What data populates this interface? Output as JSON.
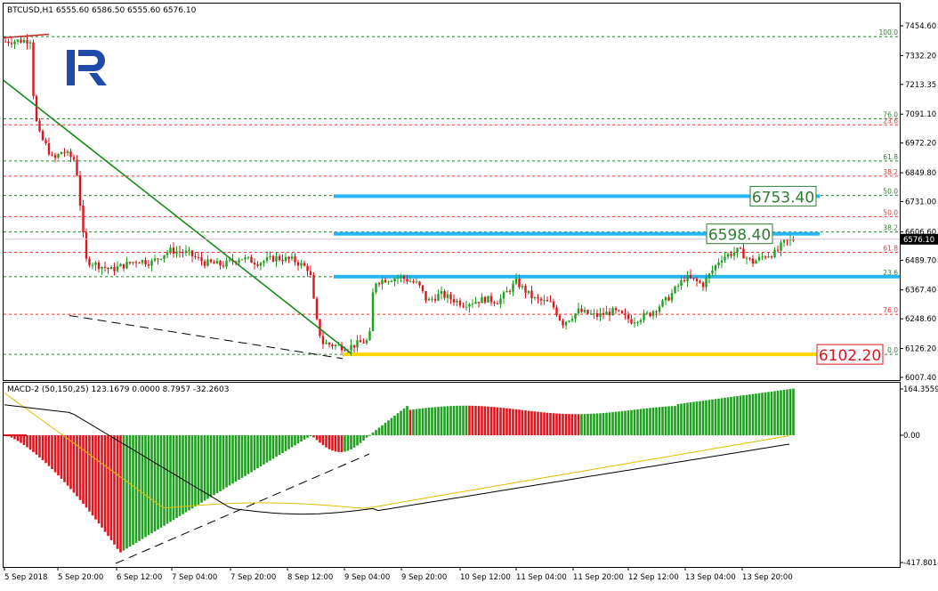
{
  "header": {
    "symbol_info": "BTCUSD,H1  6555.60 6586.50 6555.60 6576.10",
    "macd_info": "MACD-2 (50,150,25) 123.1679 0.0000 8.7957 -32.2603"
  },
  "colors": {
    "bull": "#1f9f1f",
    "bear": "#e0141e",
    "trendline": "#1a8a1a",
    "fib_green": "#2e7d32",
    "fib_red": "#e53935",
    "fib_level_line": "#2e7d32",
    "cyan_zone": "#29b6f6",
    "yellow_zone": "#ffd600",
    "macd_signal": "#e0c000",
    "macd_main": "#000000",
    "logo": "#1f4aa8"
  },
  "chart_data": [
    {
      "type": "candlestick",
      "symbol": "BTCUSD",
      "timeframe": "H1",
      "ohlc_last": {
        "open": 6555.6,
        "high": 6586.5,
        "low": 6555.6,
        "close": 6576.1
      },
      "current_price": "6576.10",
      "ylim": [
        6007.4,
        7500.0
      ],
      "y_ticks": [
        "7454.60",
        "7332.20",
        "7213.35",
        "7091.10",
        "6972.20",
        "6849.80",
        "6731.00",
        "6606.60",
        "6489.70",
        "6367.40",
        "6248.60",
        "6126.20",
        "6007.40"
      ],
      "x_ticks": [
        "5 Sep 2018",
        "5 Sep 20:00",
        "6 Sep 12:00",
        "7 Sep 04:00",
        "7 Sep 20:00",
        "8 Sep 12:00",
        "9 Sep 04:00",
        "9 Sep 20:00",
        "10 Sep 12:00",
        "11 Sep 04:00",
        "11 Sep 20:00",
        "12 Sep 12:00",
        "13 Sep 04:00",
        "13 Sep 20:00"
      ],
      "fib_levels_left": [
        {
          "label": "100.0",
          "price": 7410,
          "color": "green"
        },
        {
          "label": "76.0",
          "price": 7072,
          "color": "green"
        },
        {
          "label": "23.6",
          "price": 7047,
          "color": "red"
        },
        {
          "label": "61.8",
          "price": 6898,
          "color": "green"
        },
        {
          "label": "38.2",
          "price": 6836,
          "color": "red"
        },
        {
          "label": "50.0",
          "price": 6756,
          "color": "green"
        },
        {
          "label": "50.0",
          "price": 6669,
          "color": "red"
        },
        {
          "label": "38.2",
          "price": 6606,
          "color": "green"
        },
        {
          "label": "61.8",
          "price": 6522,
          "color": "red"
        },
        {
          "label": "23.6",
          "price": 6422,
          "color": "green"
        },
        {
          "label": "76.0",
          "price": 6267,
          "color": "red"
        },
        {
          "label": "0.0",
          "price": 6102,
          "color": "green"
        }
      ],
      "annotations": [
        {
          "text": "6753.40",
          "price": 6753.4,
          "style": "green-box"
        },
        {
          "text": "6598.40",
          "price": 6598.4,
          "style": "green-box"
        },
        {
          "text": "6102.20",
          "price": 6102.2,
          "style": "red-box"
        }
      ]
    },
    {
      "type": "bar",
      "name": "MACD-2 (50,150,25)",
      "y_ticks": [
        "164.3559",
        "0.00",
        "-417.8014"
      ],
      "ylim": [
        -417.8014,
        164.3559
      ]
    }
  ]
}
